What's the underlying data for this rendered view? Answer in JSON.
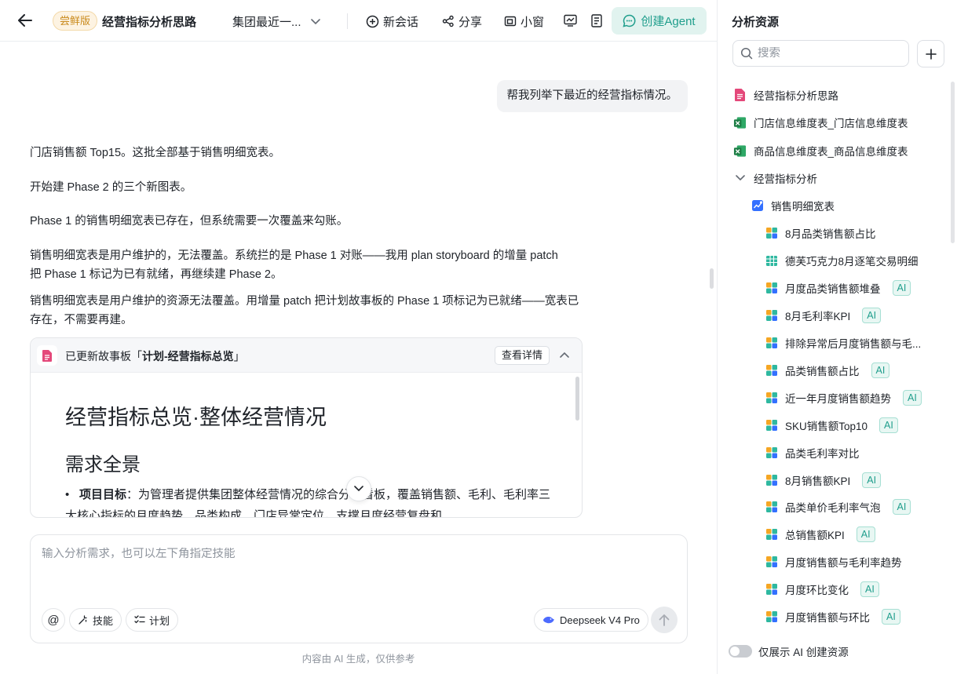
{
  "header": {
    "badge": "尝鲜版",
    "title": "经营指标分析思路",
    "datasource": "集团最近一...",
    "new_chat": "新会话",
    "share": "分享",
    "mini_window": "小窗",
    "create_agent": "创建Agent"
  },
  "chat": {
    "user_message": "帮我列举下最近的经营指标情况。",
    "ai_paragraphs": [
      "门店销售额 Top15。这批全部基于销售明细宽表。",
      "开始建 Phase 2 的三个新图表。",
      "Phase 1 的销售明细宽表已存在，但系统需要一次覆盖来勾账。",
      "销售明细宽表是用户维护的，无法覆盖。系统拦的是 Phase 1 对账——我用 plan storyboard 的增量 patch 把 Phase 1 标记为已有就绪，再继续建 Phase 2。",
      "销售明细宽表是用户维护的资源无法覆盖。用增量 patch 把计划故事板的 Phase 1 项标记为已就绪——宽表已存在，不需要再建。"
    ],
    "story_card": {
      "prefix": "已更新故事板「",
      "name": "计划-经营指标总览",
      "suffix": "」",
      "detail_button": "查看详情",
      "h1": "经营指标总览·整体经营情况",
      "h2": "需求全景",
      "item_label": "项目目标",
      "item_text": "：为管理者提供集团整体经营情况的综合分析看板，覆盖销售额、毛利、毛利率三大核心指标的月度趋势、品类构成、门店异常定位，支撑月度经营复盘和"
    }
  },
  "composer": {
    "placeholder": "输入分析需求，也可以左下角指定技能",
    "at": "@",
    "skill": "技能",
    "plan": "计划",
    "model": "Deepseek V4 Pro"
  },
  "disclaimer": "内容由 AI 生成，仅供参考",
  "side": {
    "title": "分析资源",
    "search_placeholder": "搜索",
    "ai_tag": "AI",
    "items": [
      {
        "label": "经营指标分析思路",
        "icon": "doc-icon"
      },
      {
        "label": "门店信息维度表_门店信息维度表",
        "icon": "excel-icon"
      },
      {
        "label": "商品信息维度表_商品信息维度表",
        "icon": "excel-icon"
      },
      {
        "label": "经营指标分析",
        "icon": "chevron-down-icon"
      },
      {
        "label": "销售明细宽表",
        "icon": "dataset-icon"
      },
      {
        "label": "8月品类销售额占比",
        "icon": "chart-icon",
        "ai": false
      },
      {
        "label": "德芙巧克力8月逐笔交易明细",
        "icon": "table-icon",
        "ai": false
      },
      {
        "label": "月度品类销售额堆叠",
        "icon": "chart-icon",
        "ai": true
      },
      {
        "label": "8月毛利率KPI",
        "icon": "chart-icon",
        "ai": true
      },
      {
        "label": "排除异常后月度销售额与毛...",
        "icon": "chart-icon",
        "ai": false
      },
      {
        "label": "品类销售额占比",
        "icon": "chart-icon",
        "ai": true
      },
      {
        "label": "近一年月度销售额趋势",
        "icon": "chart-icon",
        "ai": true
      },
      {
        "label": "SKU销售额Top10",
        "icon": "chart-icon",
        "ai": true
      },
      {
        "label": "品类毛利率对比",
        "icon": "chart-icon",
        "ai": false
      },
      {
        "label": "8月销售额KPI",
        "icon": "chart-icon",
        "ai": true
      },
      {
        "label": "品类单价毛利率气泡",
        "icon": "chart-icon",
        "ai": true
      },
      {
        "label": "总销售额KPI",
        "icon": "chart-icon",
        "ai": true
      },
      {
        "label": "月度销售额与毛利率趋势",
        "icon": "chart-icon",
        "ai": false
      },
      {
        "label": "月度环比变化",
        "icon": "chart-icon",
        "ai": true
      },
      {
        "label": "月度销售额与环比",
        "icon": "chart-icon",
        "ai": true
      }
    ],
    "toggle_label": "仅展示 AI 创建资源",
    "toggle_on": false
  },
  "colors": {
    "accent": "#1f9e8c",
    "accent_bg": "#e1f3ef",
    "badge_text": "#c98a1c",
    "excel_green": "#1d7d45",
    "doc_red": "#e4487a"
  }
}
